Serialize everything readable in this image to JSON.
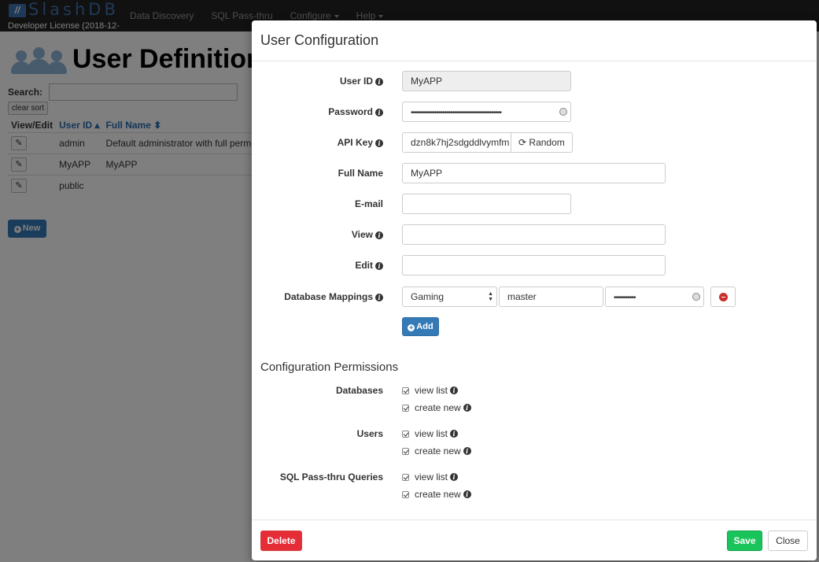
{
  "navbar": {
    "brand_name": "SlashDB",
    "license": "Developer License (2018-12-",
    "items": [
      {
        "label": "Data Discovery",
        "dropdown": false
      },
      {
        "label": "SQL Pass-thru",
        "dropdown": false
      },
      {
        "label": "Configure",
        "dropdown": true
      },
      {
        "label": "Help",
        "dropdown": true
      }
    ]
  },
  "page": {
    "title": "User Definitions",
    "search_label": "Search:",
    "search_value": "",
    "clear_sort_label": "clear sort",
    "table": {
      "headers": [
        "View/Edit",
        "User ID",
        "Full Name"
      ],
      "rows": [
        {
          "user_id": "admin",
          "full_name": "Default administrator with full permissions"
        },
        {
          "user_id": "MyAPP",
          "full_name": "MyAPP"
        },
        {
          "user_id": "public",
          "full_name": ""
        }
      ]
    },
    "new_label": "New"
  },
  "modal": {
    "title": "User Configuration",
    "fields": {
      "user_id": {
        "label": "User ID",
        "value": "MyAPP"
      },
      "password": {
        "label": "Password",
        "value": "••••••••••••••••••••••••••••••••••••••••••••••"
      },
      "api_key": {
        "label": "API Key",
        "value": "dzn8k7hj2sdgddlvymfm",
        "random_label": "Random"
      },
      "full_name": {
        "label": "Full Name",
        "value": "MyAPP"
      },
      "email": {
        "label": "E-mail",
        "value": ""
      },
      "view": {
        "label": "View",
        "value": ""
      },
      "edit": {
        "label": "Edit",
        "value": ""
      },
      "db_mappings": {
        "label": "Database Mappings",
        "database": "Gaming",
        "db_user": "master",
        "db_password": "•••••••••••"
      }
    },
    "add_label": "Add",
    "permissions": {
      "title": "Configuration Permissions",
      "groups": [
        {
          "label": "Databases",
          "options": [
            {
              "label": "view list",
              "checked": true
            },
            {
              "label": "create new",
              "checked": true
            }
          ]
        },
        {
          "label": "Users",
          "options": [
            {
              "label": "view list",
              "checked": true
            },
            {
              "label": "create new",
              "checked": true
            }
          ]
        },
        {
          "label": "SQL Pass-thru Queries",
          "options": [
            {
              "label": "view list",
              "checked": true
            },
            {
              "label": "create new",
              "checked": true
            }
          ]
        }
      ]
    },
    "footer": {
      "delete_label": "Delete",
      "save_label": "Save",
      "close_label": "Close"
    }
  },
  "colors": {
    "primary": "#337ab7",
    "danger": "#e52d37",
    "success": "#19c45b",
    "navbar": "#222222"
  }
}
